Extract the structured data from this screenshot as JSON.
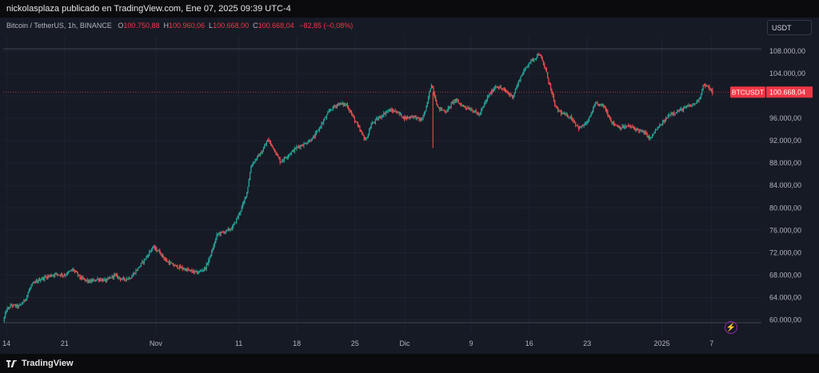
{
  "header": {
    "publisher_line": "nickolasplaza publicado en TradingView.com, Ene 07, 2025 09:39 UTC-4"
  },
  "legend": {
    "symbol": "Bitcoin / TetherUS, 1h, BINANCE",
    "o_label": "O",
    "o_value": "100.750,88",
    "h_label": "H",
    "h_value": "100.960,06",
    "l_label": "L",
    "l_value": "100.668,00",
    "c_label": "C",
    "c_value": "100.668,04",
    "change": "−82,85 (−0,08%)"
  },
  "currency_selector": "USDT",
  "price_tag": {
    "symbol": "BTCUSDT",
    "value": "100.668,04"
  },
  "footer": {
    "brand": "TradingView"
  },
  "colors": {
    "up": "#26a69a",
    "down": "#ef5350",
    "tag": "#f23645"
  },
  "chart_data": {
    "type": "candlestick",
    "symbol": "BTCUSDT",
    "interval": "1h",
    "y_ticks": [
      60000,
      64000,
      68000,
      72000,
      76000,
      80000,
      84000,
      88000,
      92000,
      96000,
      100000,
      104000,
      108000
    ],
    "y_tick_labels": [
      "60.000,00",
      "64.000,00",
      "68.000,00",
      "72.000,00",
      "76.000,00",
      "80.000,00",
      "84.000,00",
      "88.000,00",
      "92.000,00",
      "96.000,00",
      "",
      "104.000,00",
      "108.000,00"
    ],
    "ylim": [
      58000,
      113000
    ],
    "x_ticks": [
      "14",
      "21",
      "Nov",
      "11",
      "18",
      "25",
      "Dic",
      "9",
      "16",
      "23",
      "2025",
      "7"
    ],
    "x_tick_days": [
      13,
      20,
      31,
      41,
      48,
      55,
      61,
      69,
      76,
      83,
      92,
      98
    ],
    "xlim_days": [
      12.6,
      104
    ],
    "last_price": 100668.04,
    "h_lines": [
      108400,
      59500
    ],
    "close_path": [
      [
        12.6,
        59800
      ],
      [
        13.0,
        61800
      ],
      [
        13.6,
        62600
      ],
      [
        14.5,
        62400
      ],
      [
        15.2,
        63500
      ],
      [
        16.0,
        66200
      ],
      [
        17.0,
        67200
      ],
      [
        18.0,
        67800
      ],
      [
        19.0,
        68200
      ],
      [
        20.0,
        68000
      ],
      [
        21.0,
        69000
      ],
      [
        22.0,
        67400
      ],
      [
        23.0,
        66800
      ],
      [
        24.0,
        67300
      ],
      [
        25.0,
        67000
      ],
      [
        26.0,
        68000
      ],
      [
        27.0,
        67200
      ],
      [
        28.0,
        67600
      ],
      [
        29.0,
        69500
      ],
      [
        30.0,
        71500
      ],
      [
        30.6,
        73000
      ],
      [
        31.4,
        72200
      ],
      [
        32.2,
        70600
      ],
      [
        33.0,
        69800
      ],
      [
        34.0,
        69300
      ],
      [
        35.0,
        68800
      ],
      [
        36.0,
        68400
      ],
      [
        37.0,
        69300
      ],
      [
        37.8,
        72400
      ],
      [
        38.4,
        75300
      ],
      [
        39.4,
        75800
      ],
      [
        40.2,
        76400
      ],
      [
        41.0,
        78800
      ],
      [
        41.6,
        81000
      ],
      [
        42.0,
        83000
      ],
      [
        42.5,
        87600
      ],
      [
        43.2,
        89000
      ],
      [
        43.8,
        90000
      ],
      [
        44.5,
        92200
      ],
      [
        45.2,
        90600
      ],
      [
        46.0,
        88200
      ],
      [
        47.0,
        89500
      ],
      [
        48.0,
        90800
      ],
      [
        49.0,
        91500
      ],
      [
        50.0,
        92500
      ],
      [
        51.0,
        95000
      ],
      [
        52.0,
        97500
      ],
      [
        53.0,
        98600
      ],
      [
        54.0,
        98400
      ],
      [
        55.0,
        95600
      ],
      [
        55.6,
        93800
      ],
      [
        56.3,
        92000
      ],
      [
        57.0,
        95000
      ],
      [
        58.0,
        96200
      ],
      [
        59.0,
        97400
      ],
      [
        60.0,
        97200
      ],
      [
        61.0,
        96000
      ],
      [
        62.0,
        96400
      ],
      [
        63.0,
        95600
      ],
      [
        63.6,
        97800
      ],
      [
        64.2,
        102200
      ],
      [
        65.0,
        97800
      ],
      [
        66.0,
        97200
      ],
      [
        67.0,
        99300
      ],
      [
        68.0,
        98200
      ],
      [
        69.0,
        97600
      ],
      [
        70.0,
        96600
      ],
      [
        71.0,
        99800
      ],
      [
        72.0,
        101800
      ],
      [
        73.0,
        101000
      ],
      [
        74.0,
        99800
      ],
      [
        75.0,
        103500
      ],
      [
        76.0,
        106000
      ],
      [
        76.6,
        106600
      ],
      [
        77.2,
        107600
      ],
      [
        78.0,
        104600
      ],
      [
        78.6,
        101200
      ],
      [
        79.2,
        97800
      ],
      [
        80.0,
        96800
      ],
      [
        81.0,
        96200
      ],
      [
        82.0,
        94200
      ],
      [
        83.0,
        95200
      ],
      [
        84.0,
        98600
      ],
      [
        85.0,
        98200
      ],
      [
        86.0,
        95200
      ],
      [
        87.0,
        94300
      ],
      [
        88.0,
        94600
      ],
      [
        89.0,
        94000
      ],
      [
        90.0,
        93300
      ],
      [
        90.6,
        92300
      ],
      [
        91.2,
        93800
      ],
      [
        92.0,
        95000
      ],
      [
        93.0,
        96800
      ],
      [
        94.0,
        97300
      ],
      [
        95.0,
        98000
      ],
      [
        96.0,
        98600
      ],
      [
        96.6,
        99800
      ],
      [
        97.0,
        102000
      ],
      [
        97.6,
        101500
      ],
      [
        98.1,
        100668
      ]
    ]
  }
}
